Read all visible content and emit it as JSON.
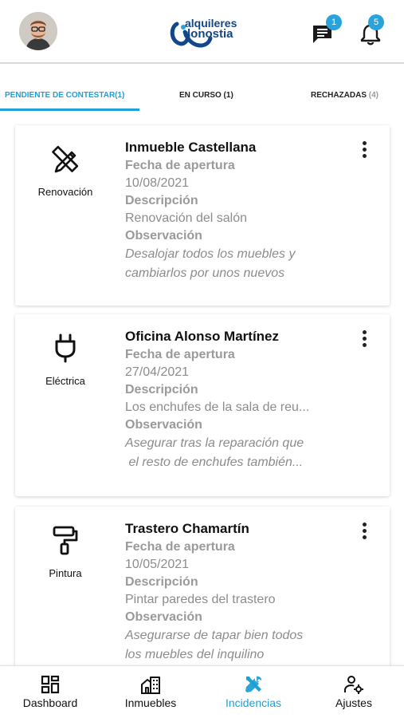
{
  "header": {
    "logo_line1": "alquileres",
    "logo_line2": "donostia",
    "messages_count": "1",
    "notifications_count": "5",
    "accent_color": "#1fa0d6",
    "logo_color": "#14468a"
  },
  "tabs": [
    {
      "label": "PENDIENTE DE CONTESTAR(1)",
      "active": true
    },
    {
      "label": "EN CURSO (1)",
      "active": false
    },
    {
      "label_main": "RECHAZADAS",
      "label_count": "(4)",
      "active": false
    }
  ],
  "cards": [
    {
      "category": "Renovación",
      "category_icon": "pencil-ruler-icon",
      "title": "Inmueble Castellana",
      "opening_label": "Fecha de apertura",
      "opening_date": "10/08/2021",
      "description_label": "Descripción",
      "description": "Renovación del salón",
      "observation_label": "Observación",
      "observation_line1": "Desalojar todos los muebles y",
      "observation_line2": "cambiarlos por unos nuevos"
    },
    {
      "category": "Eléctrica",
      "category_icon": "plug-icon",
      "title": "Oficina Alonso Martínez",
      "opening_label": "Fecha de apertura",
      "opening_date": "27/04/2021",
      "description_label": "Descripción",
      "description": "Los enchufes de la sala de reu...",
      "observation_label": "Observación",
      "observation_line1": "Asegurar tras la reparación que",
      "observation_line2": " el resto de enchufes también..."
    },
    {
      "category": "Pintura",
      "category_icon": "paint-roller-icon",
      "title": "Trastero Chamartín",
      "opening_label": "Fecha de apertura",
      "opening_date": "10/05/2021",
      "description_label": "Descripción",
      "description": "Pintar paredes del trastero",
      "observation_label": "Observación",
      "observation_line1": "Asegurarse de tapar bien todos",
      "observation_line2": "los muebles del inquilino"
    }
  ],
  "bottom_nav": [
    {
      "label": "Dashboard",
      "icon": "dashboard-icon",
      "active": false
    },
    {
      "label": "Inmuebles",
      "icon": "building-icon",
      "active": false
    },
    {
      "label": "Incidencias",
      "icon": "tools-icon",
      "active": true
    },
    {
      "label": "Ajustes",
      "icon": "user-settings-icon",
      "active": false
    }
  ]
}
